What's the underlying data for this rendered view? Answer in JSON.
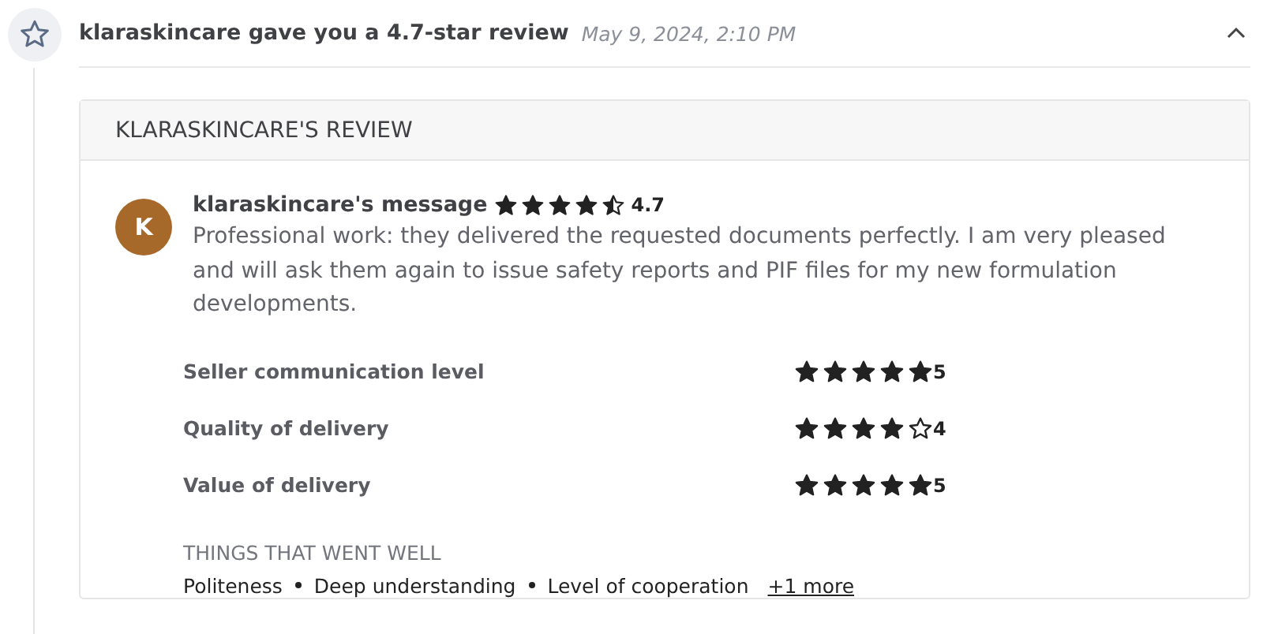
{
  "notification": {
    "title": "klaraskincare gave you a 4.7-star review",
    "time": "May 9, 2024, 2:10 PM",
    "expanded": true
  },
  "review": {
    "heading": "KLARASKINCARE'S REVIEW",
    "avatar": "K",
    "author": "klaraskincare's message",
    "stars": 4.5,
    "score": "4.7",
    "message": "Professional work: they delivered the requested documents perfectly. I am very pleased and will ask them again to issue safety reports and PIF files for my new formulation developments.",
    "ratings": [
      {
        "label": "Seller communication level",
        "stars": 5,
        "score": "5"
      },
      {
        "label": "Quality of delivery",
        "stars": 4,
        "score": "4"
      },
      {
        "label": "Value of delivery",
        "stars": 5,
        "score": "5"
      }
    ],
    "went_well": {
      "heading": "THINGS THAT WENT WELL",
      "items": [
        "Politeness",
        "Deep understanding",
        "Level of cooperation"
      ],
      "more": "+1 more"
    }
  }
}
